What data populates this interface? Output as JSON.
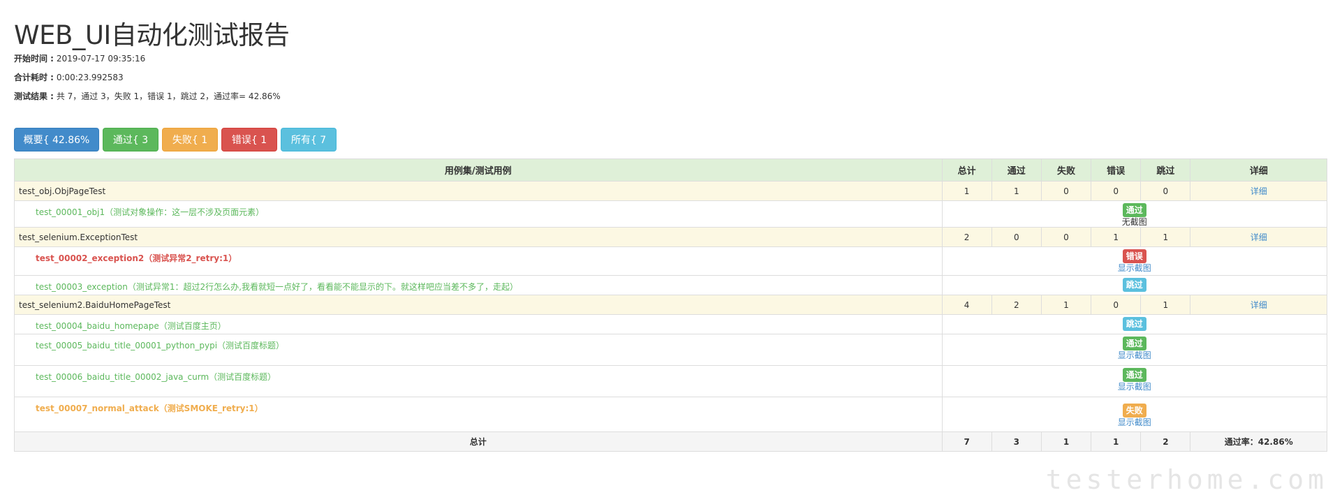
{
  "title": "WEB_UI自动化测试报告",
  "meta": {
    "start_label": "开始时间 :",
    "start_value": "2019-07-17 09:35:16",
    "duration_label": "合计耗时 :",
    "duration_value": "0:00:23.992583",
    "result_label": "测试结果 :",
    "result_value": "共 7，通过 3，失败 1，错误 1，跳过 2，通过率= 42.86%"
  },
  "filters": {
    "summary": "概要{ 42.86% }",
    "pass": "通过{ 3 }",
    "fail": "失败{ 1 }",
    "error": "错误{ 1 }",
    "all": "所有{ 7 }"
  },
  "table": {
    "headers": [
      "用例集/测试用例",
      "总计",
      "通过",
      "失败",
      "错误",
      "跳过",
      "详细"
    ],
    "suites": [
      {
        "name": "test_obj.ObjPageTest",
        "counts": [
          "1",
          "1",
          "0",
          "0",
          "0"
        ],
        "detail": "详细",
        "cases": [
          {
            "name": "test_00001_obj1（测试对象操作：这一层不涉及页面元素）",
            "status": "通过",
            "sub": "无截图"
          }
        ]
      },
      {
        "name": "test_selenium.ExceptionTest",
        "counts": [
          "2",
          "0",
          "0",
          "1",
          "1"
        ],
        "detail": "详细",
        "cases": [
          {
            "name": "test_00002_exception2（测试异常2_retry:1）",
            "status": "错误",
            "sub": "显示截图"
          },
          {
            "name": "test_00003_exception（测试异常1：超过2行怎么办,我看就短一点好了，看看能不能显示的下。就这样吧应当差不多了，走起）",
            "status": "跳过",
            "sub": ""
          }
        ]
      },
      {
        "name": "test_selenium2.BaiduHomePageTest",
        "counts": [
          "4",
          "2",
          "1",
          "0",
          "1"
        ],
        "detail": "详细",
        "cases": [
          {
            "name": "test_00004_baidu_homepape（测试百度主页）",
            "status": "跳过",
            "sub": ""
          },
          {
            "name": "test_00005_baidu_title_00001_python_pypi（测试百度标题）",
            "status": "通过",
            "sub": "显示截图"
          },
          {
            "name": "test_00006_baidu_title_00002_java_curm（测试百度标题）",
            "status": "通过",
            "sub": "显示截图"
          },
          {
            "name": "test_00007_normal_attack（测试SMOKE_retry:1）",
            "status": "失败",
            "sub": "显示截图"
          }
        ]
      }
    ],
    "total": {
      "label": "总计",
      "counts": [
        "7",
        "3",
        "1",
        "1",
        "2"
      ],
      "pass_rate": "通过率：42.86%"
    }
  },
  "watermark": "testerhome.com",
  "colors": {
    "pass": "#5cb85c",
    "fail": "#f0ad4e",
    "error": "#d9534f",
    "skip": "#5bc0de",
    "primary": "#428bca",
    "header_bg": "#dff0d8",
    "suite_bg": "#fcf8e3"
  }
}
